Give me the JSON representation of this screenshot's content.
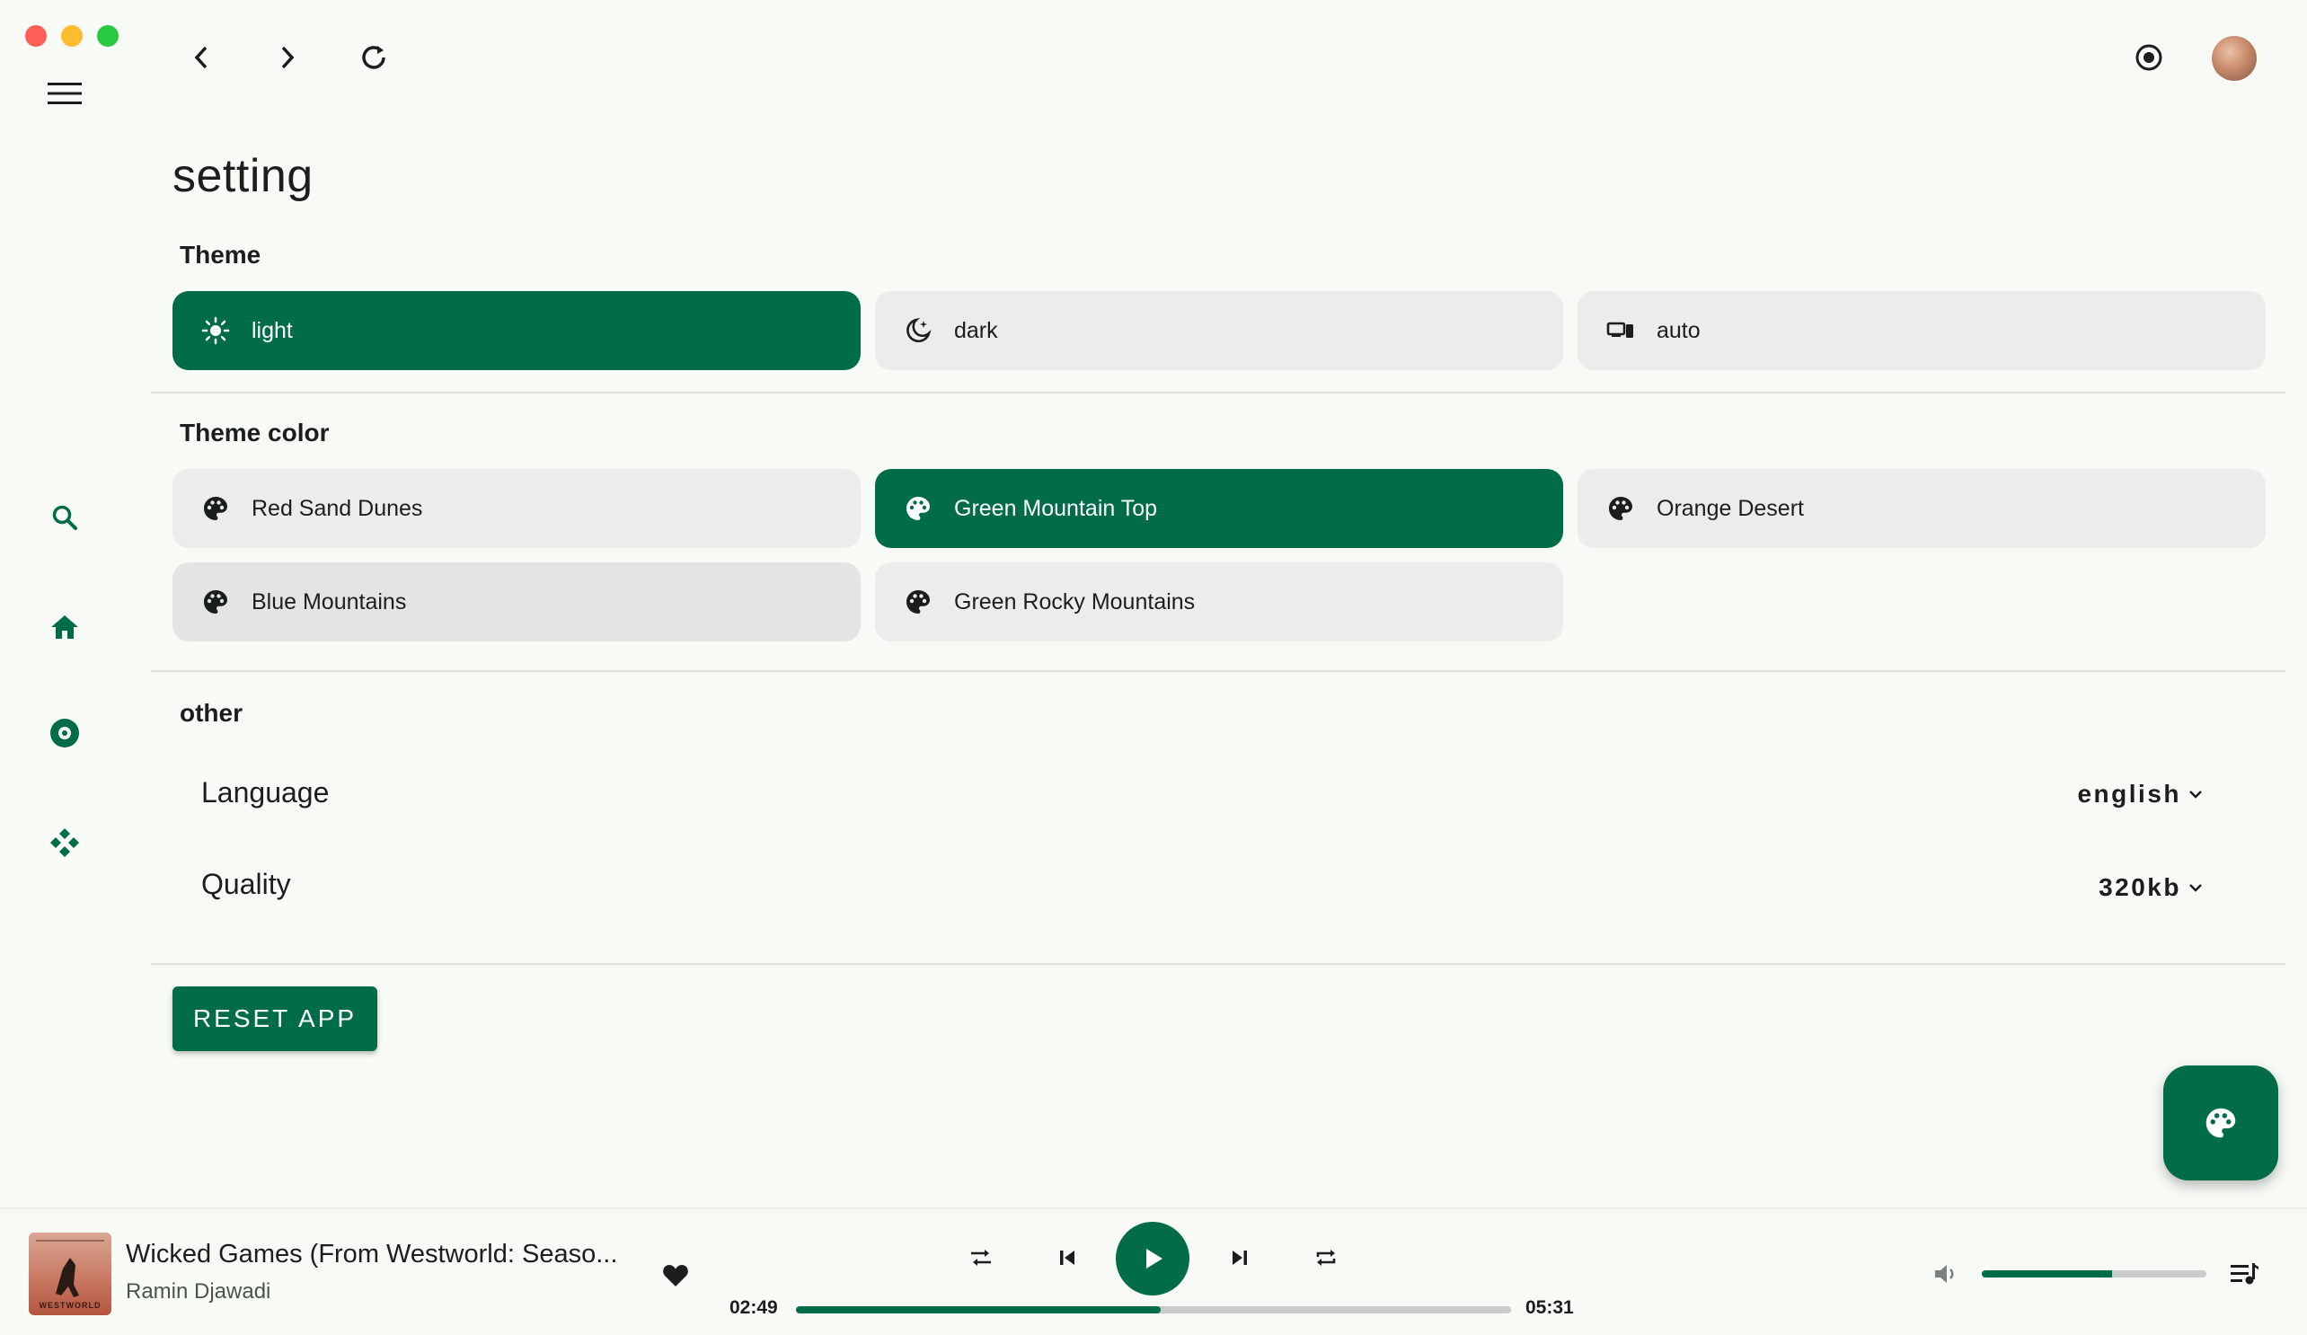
{
  "window": {
    "controls": [
      "close",
      "minimize",
      "maximize"
    ]
  },
  "toolbar": {
    "back_icon": "chevron-left-icon",
    "forward_icon": "chevron-right-icon",
    "reload_icon": "reload-icon",
    "lens_icon": "lens-icon",
    "menu_icon": "hamburger-menu-icon"
  },
  "sidebar": {
    "items": [
      {
        "name": "search",
        "icon": "search-icon"
      },
      {
        "name": "home",
        "icon": "home-icon"
      },
      {
        "name": "library",
        "icon": "disc-icon"
      },
      {
        "name": "explore",
        "icon": "diamond-grid-icon"
      }
    ]
  },
  "page": {
    "title": "setting"
  },
  "theme": {
    "heading": "Theme",
    "options": [
      {
        "label": "light",
        "icon": "sun-icon",
        "selected": true
      },
      {
        "label": "dark",
        "icon": "moon-icon",
        "selected": false
      },
      {
        "label": "auto",
        "icon": "devices-icon",
        "selected": false
      }
    ]
  },
  "theme_color": {
    "heading": "Theme color",
    "options": [
      {
        "label": "Red Sand Dunes",
        "icon": "palette-icon",
        "selected": false
      },
      {
        "label": "Green Mountain Top",
        "icon": "palette-icon",
        "selected": true
      },
      {
        "label": "Orange Desert",
        "icon": "palette-icon",
        "selected": false
      },
      {
        "label": "Blue Mountains",
        "icon": "palette-icon",
        "selected": false
      },
      {
        "label": "Green Rocky Mountains",
        "icon": "palette-icon",
        "selected": false
      }
    ]
  },
  "other": {
    "heading": "other",
    "language": {
      "label": "Language",
      "value": "english"
    },
    "quality": {
      "label": "Quality",
      "value": "320kb"
    }
  },
  "reset": {
    "label": "RESET APP"
  },
  "fab": {
    "icon": "palette-icon"
  },
  "player": {
    "cover_text": "WESTWORLD",
    "title": "Wicked Games (From Westworld: Seaso...",
    "artist": "Ramin Djawadi",
    "current_time": "02:49",
    "total_time": "05:31",
    "progress": 0.51,
    "volume": 0.58,
    "liked": true
  },
  "colors": {
    "accent": "#006d48",
    "background": "#f7faf5",
    "chip": "#ececec"
  }
}
